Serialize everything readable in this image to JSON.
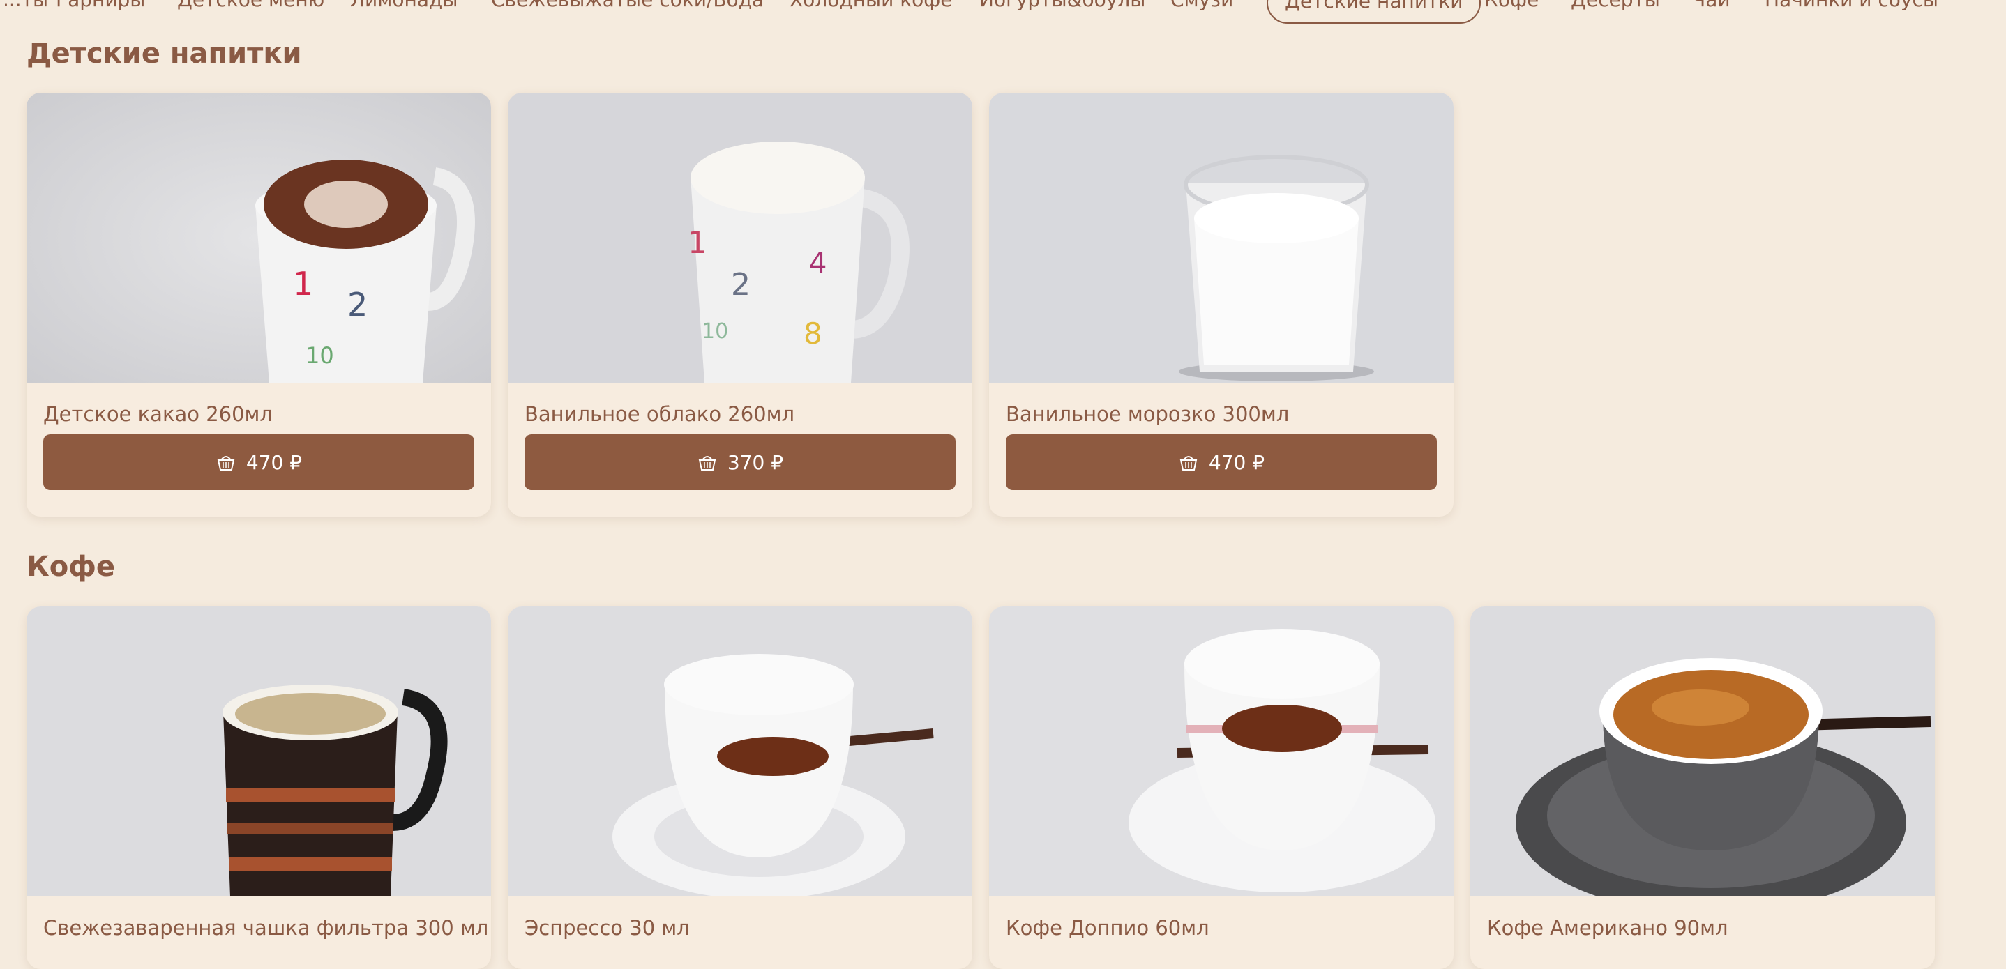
{
  "nav": {
    "items": [
      "...ты",
      "Гарниры",
      "Детское меню",
      "Лимонады",
      "Свежевыжатые соки/Вода",
      "Холодный кофе",
      "Йогурты&боулы",
      "Смузи",
      "Детские напитки",
      "Кофе",
      "Десерты",
      "Чай",
      "Начинки и соусы"
    ],
    "active": "Детские напитки"
  },
  "sections": [
    {
      "title": "Детские напитки",
      "items": [
        {
          "name": "Детское какао 260мл",
          "price": "470 ₽"
        },
        {
          "name": "Ванильное облако 260мл",
          "price": "370 ₽"
        },
        {
          "name": "Ванильное морозко 300мл",
          "price": "470 ₽"
        }
      ]
    },
    {
      "title": "Кофе",
      "items": [
        {
          "name": "Свежезаваренная чашка фильтра 300 мл"
        },
        {
          "name": "Эспрессо 30 мл"
        },
        {
          "name": "Кофе Доппио 60мл"
        },
        {
          "name": "Кофе Американо 90мл"
        }
      ]
    }
  ],
  "icons": {
    "price_button": "basket-icon"
  },
  "colors": {
    "background": "#f5ebde",
    "accent": "#8e5a40",
    "text": "#8a5a44"
  }
}
